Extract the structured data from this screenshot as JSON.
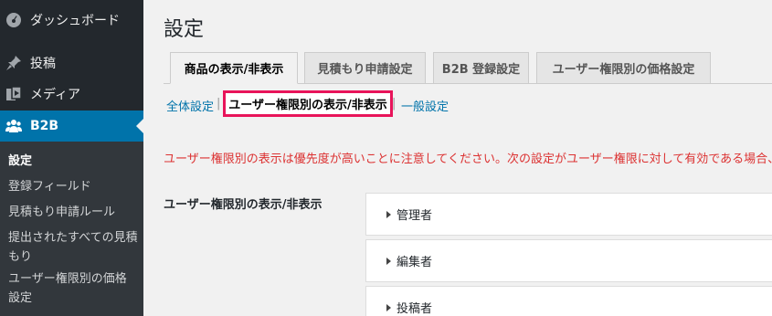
{
  "sidebar": {
    "items": [
      {
        "label": "ダッシュボード",
        "icon": "dashboard-icon"
      },
      {
        "label": "投稿",
        "icon": "pushpin-icon"
      },
      {
        "label": "メディア",
        "icon": "media-icon"
      },
      {
        "label": "B2B",
        "icon": "people-icon"
      }
    ],
    "submenu": [
      "設定",
      "登録フィールド",
      "見積もり申請ルール",
      "提出されたすべての見積もり",
      "ユーザー権限別の価格設定"
    ]
  },
  "page": {
    "title": "設定",
    "tabs": [
      "商品の表示/非表示",
      "見積もり申請設定",
      "B2B 登録設定",
      "ユーザー権限別の価格設定"
    ],
    "subnav": [
      "全体設定",
      "ユーザー権限別の表示/非表示",
      "一般設定"
    ],
    "separator": "|",
    "notice": "ユーザー権限別の表示は優先度が高いことに注意してください。次の設定がユーザー権限に対して有効である場合、",
    "row_label": "ユーザー権限別の表示/非表示",
    "roles": [
      "管理者",
      "編集者",
      "投稿者"
    ]
  },
  "colors": {
    "sidebar_bg": "#23282d",
    "submenu_bg": "#32373c",
    "accent": "#0073aa",
    "notice": "#dc3232",
    "highlight_border": "#e8145a"
  }
}
